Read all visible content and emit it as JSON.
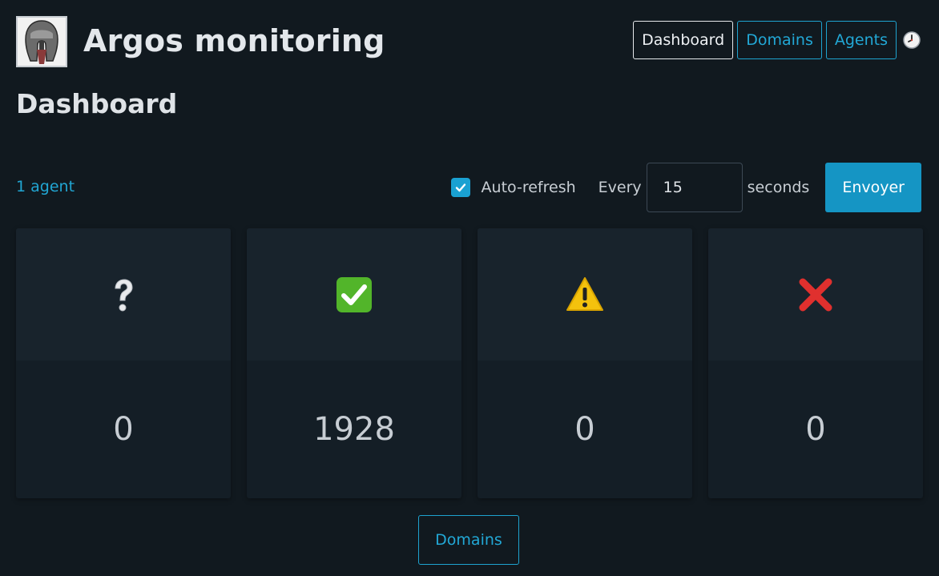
{
  "header": {
    "app_title": "Argos monitoring",
    "nav": [
      {
        "label": "Dashboard",
        "active": true
      },
      {
        "label": "Domains",
        "active": false
      },
      {
        "label": "Agents",
        "active": false
      }
    ],
    "clock_icon": "clock-icon"
  },
  "page": {
    "title": "Dashboard"
  },
  "toolbar": {
    "agents_link": "1 agent",
    "auto_refresh_checked": true,
    "auto_refresh_label": "Auto-refresh",
    "every_label": "Every",
    "interval_value": "15",
    "seconds_label": "seconds",
    "submit_label": "Envoyer"
  },
  "cards": [
    {
      "icon": "question-mark-icon",
      "count": "0"
    },
    {
      "icon": "check-mark-icon",
      "count": "1928"
    },
    {
      "icon": "warning-icon",
      "count": "0"
    },
    {
      "icon": "cross-mark-icon",
      "count": "0"
    }
  ],
  "footer": {
    "domains_button": "Domains"
  },
  "colors": {
    "background": "#11191f",
    "accent": "#1ea3cf",
    "primary_button": "#1595c4",
    "success": "#4cbb17",
    "warning": "#f4c20d",
    "error": "#e0302e"
  }
}
